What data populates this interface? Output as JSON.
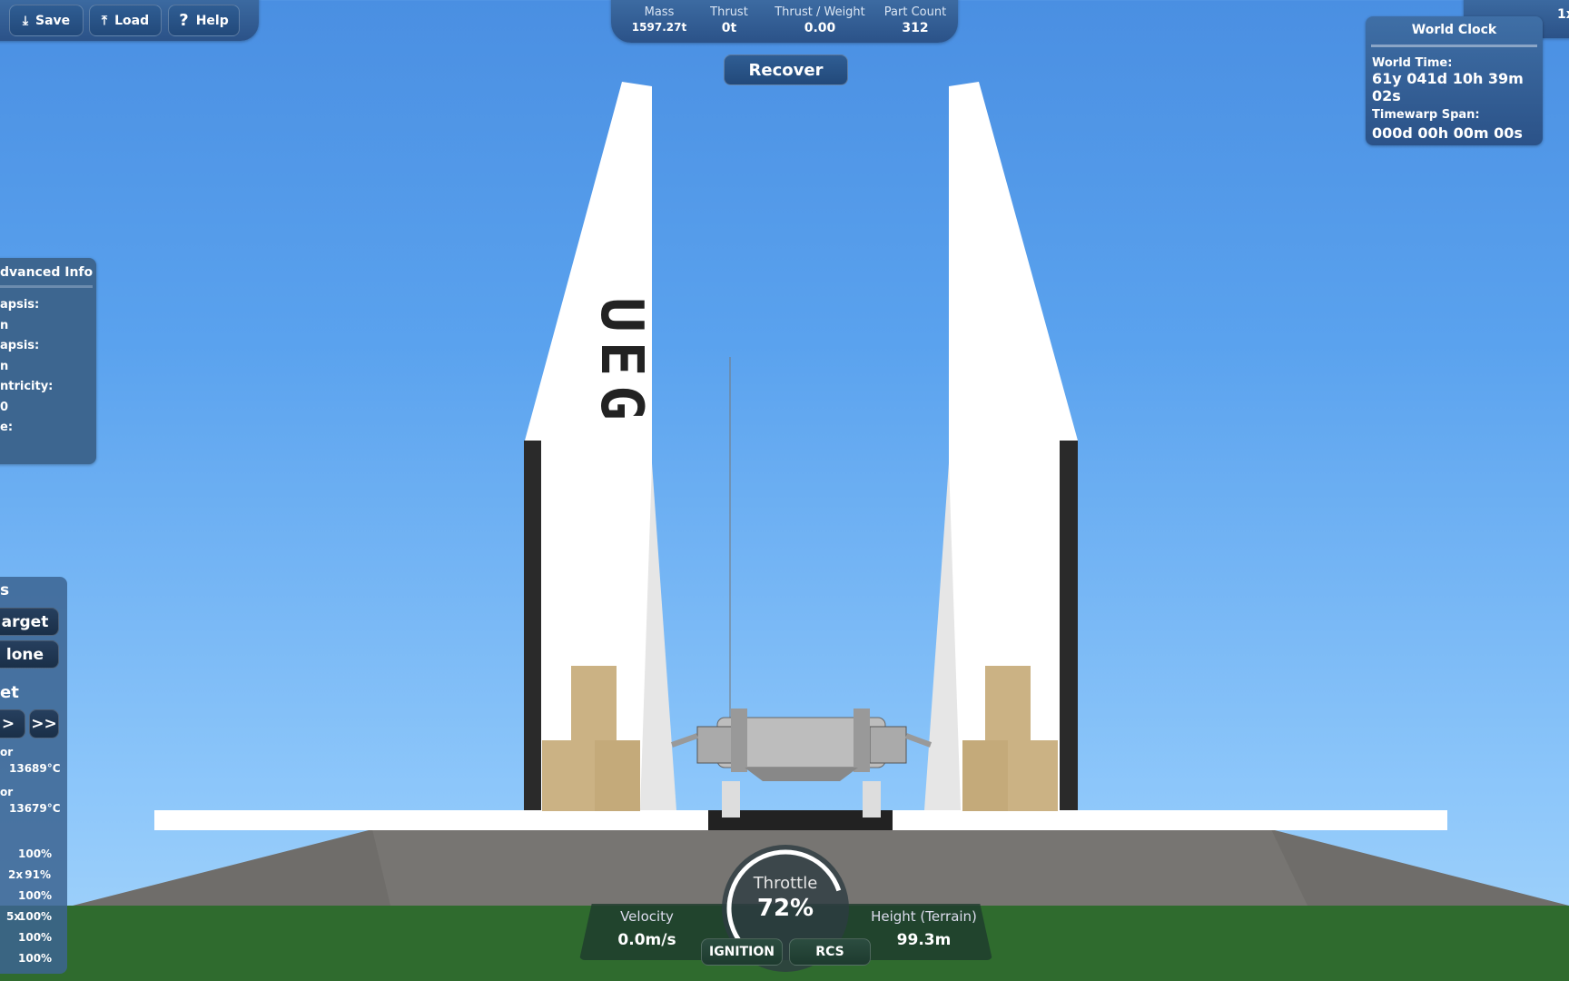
{
  "toolbar": {
    "save": "Save",
    "load": "Load",
    "help": "Help"
  },
  "stats": [
    {
      "label": "Mass",
      "value": "1597.27t"
    },
    {
      "label": "Thrust",
      "value": "0t"
    },
    {
      "label": "Thrust / Weight",
      "value": "0.00"
    },
    {
      "label": "Part Count",
      "value": "312"
    }
  ],
  "recover": "Recover",
  "timewarp_label": "1x",
  "world_clock": {
    "title": "World Clock",
    "time_label": "World Time:",
    "time": "61y 041d 10h 39m 02s",
    "span_label": "Timewarp Span:",
    "span": "000d 00h 00m 00s"
  },
  "advanced": {
    "title": "dvanced Info",
    "rows": [
      "apsis:",
      "n",
      "apsis:",
      "n",
      "ntricity:",
      "0",
      "e:"
    ]
  },
  "target": {
    "title": "s",
    "btn1": "arget",
    "btn2": "lone",
    "section": "et",
    "next": ">",
    "fast": ">>"
  },
  "parts": {
    "r1": "or",
    "t1": "13689°C",
    "r2": "or",
    "t2": "13679°C",
    "rows": [
      {
        "m": "",
        "p": "100%"
      },
      {
        "m": "2x",
        "p": "91%"
      },
      {
        "m": "",
        "p": "100%"
      },
      {
        "m": "5x",
        "p": "100%"
      },
      {
        "m": "",
        "p": "100%"
      },
      {
        "m": "",
        "p": "100%"
      }
    ]
  },
  "vehicle_text": "UEG",
  "flight": {
    "velocity_label": "Velocity",
    "velocity": "0.0m/s",
    "throttle_label": "Throttle",
    "throttle": "72%",
    "throttle_value": 72,
    "height_label": "Height (Terrain)",
    "height": "99.3m",
    "ignition": "IGNITION",
    "rcs": "RCS"
  }
}
